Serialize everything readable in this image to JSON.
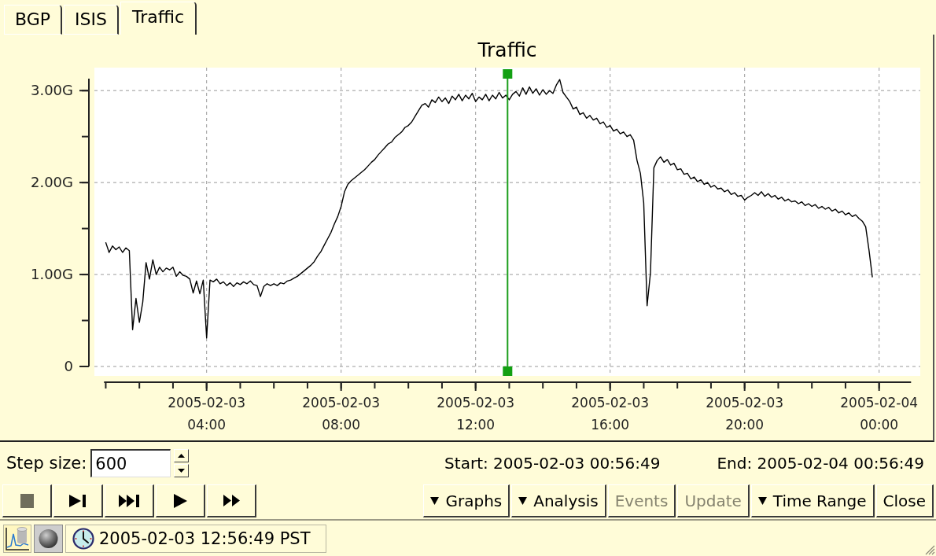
{
  "tabs": [
    {
      "label": "BGP",
      "selected": false
    },
    {
      "label": "ISIS",
      "selected": false
    },
    {
      "label": "Traffic",
      "selected": true
    }
  ],
  "panel": {
    "chart_data": {
      "type": "line",
      "title": "Traffic",
      "grid": true,
      "ylim": [
        0,
        3.13
      ],
      "yticks": [
        {
          "value": 0,
          "label": "0"
        },
        {
          "value": 1,
          "label": "1.00G"
        },
        {
          "value": 2,
          "label": "2.00G"
        },
        {
          "value": 3,
          "label": "3.00G"
        }
      ],
      "categories": [
        null,
        null,
        null,
        null,
        null,
        null,
        null,
        null,
        null,
        null,
        null,
        null,
        null,
        null,
        null,
        null,
        null,
        null,
        null,
        null,
        null,
        null,
        null,
        null,
        null,
        null,
        null,
        null,
        null,
        null,
        "2005-02-03 04:00",
        null,
        null,
        null,
        null,
        null,
        null,
        null,
        null,
        null,
        null,
        null,
        null,
        null,
        null,
        null,
        null,
        null,
        null,
        null,
        null,
        null,
        null,
        null,
        null,
        null,
        null,
        null,
        null,
        null,
        null,
        null,
        null,
        null,
        null,
        null,
        null,
        null,
        null,
        null,
        "2005-02-03 08:00",
        null,
        null,
        null,
        null,
        null,
        null,
        null,
        null,
        null,
        null,
        null,
        null,
        null,
        null,
        null,
        null,
        null,
        null,
        null,
        null,
        null,
        null,
        null,
        null,
        null,
        null,
        null,
        null,
        null,
        null,
        null,
        null,
        null,
        null,
        null,
        null,
        null,
        null,
        null,
        "2005-02-03 12:00",
        null,
        null,
        null,
        null,
        null,
        null,
        null,
        null,
        null,
        null,
        null,
        null,
        null,
        null,
        null,
        null,
        null,
        null,
        null,
        null,
        null,
        null,
        null,
        null,
        null,
        null,
        null,
        null,
        null,
        null,
        null,
        null,
        null,
        null,
        null,
        null,
        null,
        null,
        null,
        "2005-02-03 16:00",
        null,
        null,
        null,
        null,
        null,
        null,
        null,
        null,
        null,
        null,
        null,
        null,
        null,
        null,
        null,
        null,
        null,
        null,
        null,
        null,
        null,
        null,
        null,
        null,
        null,
        null,
        null,
        null,
        null,
        null,
        null,
        null,
        null,
        null,
        null,
        null,
        null,
        null,
        null,
        "2005-02-03 20:00",
        null,
        null,
        null,
        null,
        null,
        null,
        null,
        null,
        null,
        null,
        null,
        null,
        null,
        null,
        null,
        null,
        null,
        null,
        null,
        null,
        null,
        null,
        null,
        null,
        null,
        null,
        null,
        null,
        null,
        null,
        null,
        null,
        null,
        null,
        null,
        null,
        null,
        null,
        null,
        "2005-02-04 00:00",
        null,
        null,
        null,
        null,
        null,
        null,
        null,
        null,
        null
      ],
      "series": [
        {
          "color": "#000000",
          "values": [
            1.35,
            1.24,
            1.31,
            1.27,
            1.3,
            1.24,
            1.29,
            1.26,
            0.4,
            0.74,
            0.48,
            0.7,
            1.13,
            0.95,
            1.16,
            1.0,
            1.08,
            1.03,
            1.07,
            1.05,
            1.08,
            0.98,
            1.03,
            0.99,
            0.98,
            0.95,
            0.8,
            0.93,
            0.79,
            0.94,
            0.31,
            0.94,
            0.92,
            0.95,
            0.9,
            0.92,
            0.88,
            0.91,
            0.87,
            0.91,
            0.89,
            0.92,
            0.9,
            0.93,
            0.89,
            0.88,
            0.76,
            0.87,
            0.9,
            0.88,
            0.9,
            0.88,
            0.91,
            0.9,
            0.93,
            0.94,
            0.96,
            0.98,
            1.01,
            1.04,
            1.07,
            1.1,
            1.14,
            1.2,
            1.25,
            1.32,
            1.39,
            1.46,
            1.55,
            1.63,
            1.74,
            1.9,
            1.98,
            2.02,
            2.05,
            2.08,
            2.11,
            2.14,
            2.18,
            2.22,
            2.25,
            2.3,
            2.34,
            2.38,
            2.42,
            2.44,
            2.49,
            2.52,
            2.55,
            2.6,
            2.62,
            2.66,
            2.72,
            2.78,
            2.84,
            2.86,
            2.82,
            2.9,
            2.87,
            2.93,
            2.88,
            2.92,
            2.86,
            2.94,
            2.9,
            2.96,
            2.89,
            2.95,
            2.91,
            2.97,
            2.88,
            2.93,
            2.9,
            2.96,
            2.89,
            2.95,
            2.91,
            2.98,
            2.92,
            2.95,
            2.9,
            2.96,
            2.99,
            2.94,
            3.03,
            2.96,
            3.04,
            2.97,
            3.02,
            2.95,
            3.01,
            2.96,
            3.0,
            2.97,
            3.06,
            3.12,
            2.98,
            2.93,
            2.88,
            2.8,
            2.82,
            2.74,
            2.76,
            2.7,
            2.73,
            2.68,
            2.7,
            2.64,
            2.66,
            2.6,
            2.62,
            2.56,
            2.58,
            2.53,
            2.55,
            2.5,
            2.52,
            2.46,
            2.24,
            2.1,
            1.78,
            0.66,
            1.02,
            2.16,
            2.24,
            2.28,
            2.22,
            2.25,
            2.19,
            2.21,
            2.14,
            2.15,
            2.09,
            2.1,
            2.04,
            2.06,
            2.01,
            2.03,
            1.98,
            2.0,
            1.95,
            1.97,
            1.93,
            1.94,
            1.9,
            1.92,
            1.87,
            1.89,
            1.85,
            1.86,
            1.81,
            1.84,
            1.86,
            1.89,
            1.86,
            1.9,
            1.85,
            1.88,
            1.84,
            1.86,
            1.82,
            1.84,
            1.8,
            1.82,
            1.79,
            1.8,
            1.77,
            1.79,
            1.75,
            1.77,
            1.74,
            1.76,
            1.72,
            1.74,
            1.71,
            1.73,
            1.69,
            1.71,
            1.67,
            1.69,
            1.65,
            1.67,
            1.63,
            1.65,
            1.61,
            1.58,
            1.52,
            1.26,
            0.97,
            null,
            null,
            null,
            null,
            null,
            null,
            null,
            null,
            null,
            null,
            null
          ]
        }
      ]
    },
    "cursor": {
      "level": 0.5
    }
  },
  "step_size": {
    "label": "Step size:",
    "value": "600"
  },
  "range": {
    "start": "Start: 2005-02-03 00:56:49",
    "end": "End: 2005-02-04 00:56:49"
  },
  "playback_buttons": [
    {
      "kind": "stop",
      "disabled": true
    },
    {
      "kind": "step",
      "disabled": false
    },
    {
      "kind": "multi_step",
      "disabled": false
    },
    {
      "kind": "play",
      "disabled": false
    },
    {
      "kind": "fast_forward",
      "disabled": false
    }
  ],
  "action_buttons": [
    {
      "label": "Graphs",
      "kind": "menu",
      "disabled": false
    },
    {
      "label": "Analysis",
      "kind": "menu",
      "disabled": false
    },
    {
      "label": "Events",
      "kind": "push",
      "disabled": true
    },
    {
      "label": "Update",
      "kind": "push",
      "disabled": true
    },
    {
      "label": "Time Range",
      "kind": "menu",
      "disabled": false
    },
    {
      "label": "Close",
      "kind": "push",
      "disabled": false
    }
  ],
  "status_bar": {
    "time": "2005-02-03 12:56:49 PST"
  }
}
